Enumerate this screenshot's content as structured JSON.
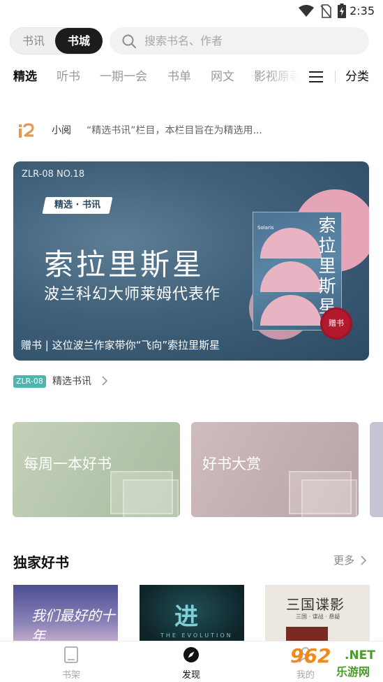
{
  "status_bar": {
    "time": "2:35"
  },
  "header": {
    "segment": {
      "news": "书讯",
      "store": "书城"
    },
    "search_placeholder": "搜索书名、作者"
  },
  "tabs": {
    "items": [
      "精选",
      "听书",
      "一期一会",
      "书单",
      "网文",
      "影视原著"
    ],
    "active": "精选",
    "category_label": "分类"
  },
  "article": {
    "logo_text": "i2",
    "author": "小阅",
    "description": "“精选书讯”栏目，本栏目旨在为精选用..."
  },
  "banner": {
    "code": "ZLR-08 NO.18",
    "tag": "精选 · 书讯",
    "title": "索拉里斯星",
    "subtitle": "波兰科幻大师莱姆代表作",
    "caption": "赠书 | 这位波兰作家带你“飞向”索拉里斯星",
    "book_label": "Solaris",
    "book_vertical": "索拉里斯星",
    "seal": "赠书",
    "colors": {
      "bg": "#40607a",
      "accent": "#e6a5b7",
      "seal": "#b3192d"
    }
  },
  "section_tag": {
    "badge": "ZLR-08",
    "title": "精选书讯",
    "badge_color": "#4cb5b0"
  },
  "cards": [
    {
      "label": "每周一本好书"
    },
    {
      "label": "好书大赏"
    }
  ],
  "exclusive": {
    "title": "独家好书",
    "more": "更多",
    "books": [
      {
        "cover_text": "我们最好的十年"
      },
      {
        "cover_text": "进",
        "cover_sub": "THE EVOLUTION"
      },
      {
        "cover_text": "三国谍影",
        "cover_sub": "三国 · 谍战 · 悬疑"
      }
    ]
  },
  "bottom_nav": {
    "items": [
      {
        "label": "书架",
        "icon": "bookshelf-icon"
      },
      {
        "label": "发现",
        "icon": "compass-icon",
        "active": true
      },
      {
        "label": "我的",
        "icon": "profile-icon"
      }
    ]
  },
  "watermark": {
    "number": "962",
    "net": ".NET",
    "site": "乐游网"
  }
}
